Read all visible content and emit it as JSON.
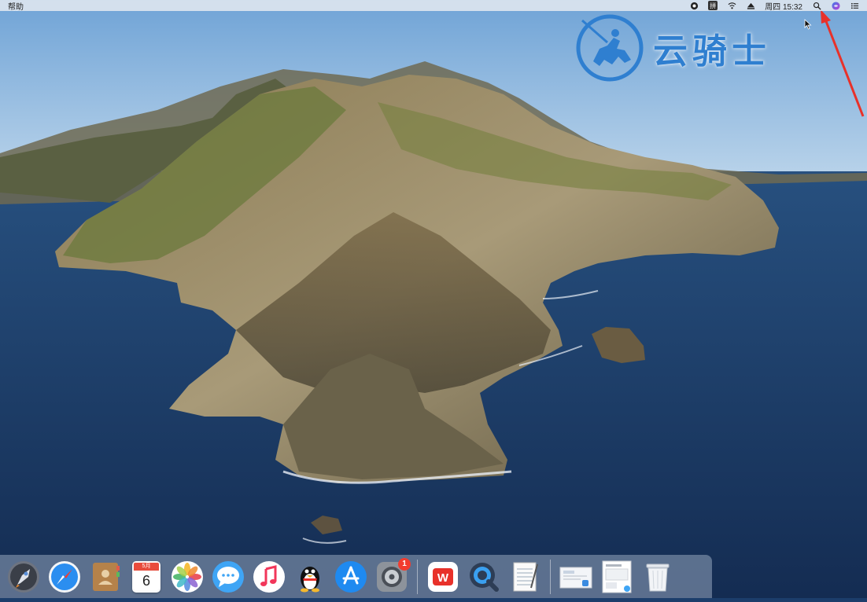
{
  "menubar": {
    "app_menu_item": "帮助",
    "clock": "周四 15:32",
    "status_icons": [
      "record-icon",
      "input-method-icon",
      "wifi-icon",
      "eject-icon",
      "spotlight-search-icon",
      "siri-icon",
      "notification-center-icon"
    ],
    "input_method_label": "拼"
  },
  "watermark": {
    "text": "云骑士",
    "color": "#2f7fd0"
  },
  "dock": {
    "apps": [
      {
        "name": "Launchpad",
        "icon": "launchpad-icon"
      },
      {
        "name": "Safari",
        "icon": "safari-icon"
      },
      {
        "name": "Contacts",
        "icon": "contacts-icon"
      },
      {
        "name": "Calendar",
        "icon": "calendar-icon",
        "month": "5月",
        "day": "6"
      },
      {
        "name": "Photos",
        "icon": "photos-icon"
      },
      {
        "name": "Messages",
        "icon": "messages-icon"
      },
      {
        "name": "Music",
        "icon": "music-icon"
      },
      {
        "name": "QQ",
        "icon": "qq-penguin-icon"
      },
      {
        "name": "App Store",
        "icon": "app-store-icon"
      },
      {
        "name": "System Preferences",
        "icon": "system-preferences-icon",
        "badge": "1"
      },
      {
        "name": "WPS",
        "icon": "wps-icon",
        "label": "W"
      },
      {
        "name": "QuickTime Player",
        "icon": "quicktime-icon"
      },
      {
        "name": "TextEdit",
        "icon": "textedit-icon"
      },
      {
        "name": "Downloads folder",
        "icon": "downloads-stack-icon"
      },
      {
        "name": "Document stack",
        "icon": "document-stack-icon"
      },
      {
        "name": "Trash",
        "icon": "trash-icon"
      }
    ]
  },
  "colors": {
    "sky": "#9ec3e6",
    "ocean": "#1c3d6b",
    "annotation_arrow": "#e8312a"
  }
}
